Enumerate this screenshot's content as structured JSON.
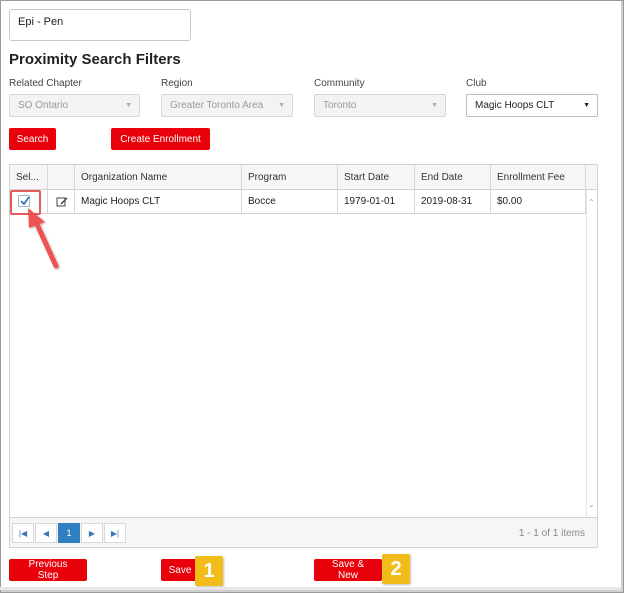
{
  "textarea": {
    "value": "Epi - Pen"
  },
  "filters": {
    "title": "Proximity Search Filters",
    "chapter": {
      "label": "Related Chapter",
      "value": "SO Ontario"
    },
    "region": {
      "label": "Region",
      "value": "Greater Toronto Area"
    },
    "community": {
      "label": "Community",
      "value": "Toronto"
    },
    "club": {
      "label": "Club",
      "value": "Magic Hoops CLT"
    }
  },
  "buttons": {
    "search": "Search",
    "create_enrollment": "Create Enrollment",
    "previous_step": "Previous Step",
    "save": "Save",
    "save_new": "Save & New"
  },
  "grid": {
    "columns": [
      "Sel...",
      "",
      "Organization Name",
      "Program",
      "Start Date",
      "End Date",
      "Enrollment Fee"
    ],
    "rows": [
      {
        "selected": true,
        "organization": "Magic Hoops CLT",
        "program": "Bocce",
        "start_date": "1979-01-01",
        "end_date": "2019-08-31",
        "fee": "$0.00"
      }
    ],
    "pager": {
      "current_page": "1",
      "info": "1 - 1 of 1 items"
    }
  },
  "annotations": {
    "badge_1": "1",
    "badge_2": "2"
  },
  "colors": {
    "accent": "#e8000b",
    "highlight": "#e45b5b",
    "badge": "#f2bd1a",
    "pager_active": "#2f7fc1"
  }
}
